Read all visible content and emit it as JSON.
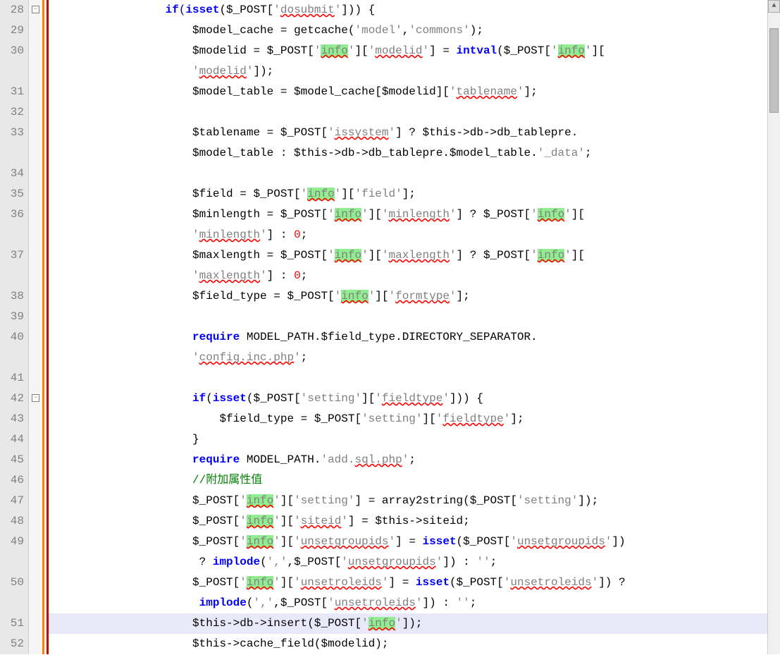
{
  "line_numbers": [
    "28",
    "29",
    "30",
    "31",
    "32",
    "33",
    "34",
    "35",
    "36",
    "37",
    "38",
    "39",
    "40",
    "41",
    "42",
    "43",
    "44",
    "45",
    "46",
    "47",
    "48",
    "49",
    "50",
    "51",
    "52"
  ],
  "tall_lines": [
    30,
    33,
    36,
    37,
    40,
    49,
    50
  ],
  "fold_marks": [
    {
      "line": 28,
      "type": "minus"
    },
    {
      "line": 42,
      "type": "minus"
    }
  ],
  "code": {
    "l28": {
      "indent": "                ",
      "tokens": [
        {
          "t": "if",
          "c": "kw"
        },
        {
          "t": "(",
          "c": "op"
        },
        {
          "t": "isset",
          "c": "kw"
        },
        {
          "t": "($_POST[",
          "c": "var"
        },
        {
          "t": "'",
          "c": "str"
        },
        {
          "t": "dosubmit",
          "c": "str wavy"
        },
        {
          "t": "'",
          "c": "str"
        },
        {
          "t": "])) {",
          "c": "var"
        }
      ]
    },
    "l29": {
      "indent": "                    ",
      "tokens": [
        {
          "t": "$model_cache = ",
          "c": "var"
        },
        {
          "t": "getcache",
          "c": "func"
        },
        {
          "t": "(",
          "c": "var"
        },
        {
          "t": "'model'",
          "c": "str"
        },
        {
          "t": ",",
          "c": "var"
        },
        {
          "t": "'commons'",
          "c": "str"
        },
        {
          "t": ");",
          "c": "var"
        }
      ]
    },
    "l30": {
      "indent": "                    ",
      "tokens": [
        {
          "t": "$modelid = $_POST[",
          "c": "var"
        },
        {
          "t": "'",
          "c": "str"
        },
        {
          "t": "info",
          "c": "str hl wavy"
        },
        {
          "t": "'",
          "c": "str"
        },
        {
          "t": "][",
          "c": "var"
        },
        {
          "t": "'",
          "c": "str"
        },
        {
          "t": "modelid",
          "c": "str wavy"
        },
        {
          "t": "'",
          "c": "str"
        },
        {
          "t": "] = ",
          "c": "var"
        },
        {
          "t": "intval",
          "c": "kw"
        },
        {
          "t": "($_POST[",
          "c": "var"
        },
        {
          "t": "'",
          "c": "str"
        },
        {
          "t": "info",
          "c": "str hl wavy"
        },
        {
          "t": "'",
          "c": "str"
        },
        {
          "t": "][",
          "c": "var"
        }
      ]
    },
    "l30b": {
      "indent": "                    ",
      "tokens": [
        {
          "t": "'",
          "c": "str"
        },
        {
          "t": "modelid",
          "c": "str wavy"
        },
        {
          "t": "'",
          "c": "str"
        },
        {
          "t": "]);",
          "c": "var"
        }
      ]
    },
    "l31": {
      "indent": "                    ",
      "tokens": [
        {
          "t": "$model_table = $model_cache[$modelid][",
          "c": "var"
        },
        {
          "t": "'",
          "c": "str"
        },
        {
          "t": "tablename",
          "c": "str wavy"
        },
        {
          "t": "'",
          "c": "str"
        },
        {
          "t": "];",
          "c": "var"
        }
      ]
    },
    "l32": {
      "indent": "",
      "tokens": []
    },
    "l33": {
      "indent": "                    ",
      "tokens": [
        {
          "t": "$tablename = $_POST[",
          "c": "var"
        },
        {
          "t": "'",
          "c": "str"
        },
        {
          "t": "issystem",
          "c": "str wavy"
        },
        {
          "t": "'",
          "c": "str"
        },
        {
          "t": "] ? $this->db->db_tablepre.",
          "c": "var"
        }
      ]
    },
    "l33b": {
      "indent": "                    ",
      "tokens": [
        {
          "t": "$model_table : $this->db->db_tablepre.$model_table.",
          "c": "var"
        },
        {
          "t": "'_data'",
          "c": "str"
        },
        {
          "t": ";",
          "c": "var"
        }
      ]
    },
    "l34": {
      "indent": "",
      "tokens": []
    },
    "l35": {
      "indent": "                    ",
      "tokens": [
        {
          "t": "$field = $_POST[",
          "c": "var"
        },
        {
          "t": "'",
          "c": "str"
        },
        {
          "t": "info",
          "c": "str hl wavy"
        },
        {
          "t": "'",
          "c": "str"
        },
        {
          "t": "][",
          "c": "var"
        },
        {
          "t": "'field'",
          "c": "str"
        },
        {
          "t": "];",
          "c": "var"
        }
      ]
    },
    "l36": {
      "indent": "                    ",
      "tokens": [
        {
          "t": "$minlength = $_POST[",
          "c": "var"
        },
        {
          "t": "'",
          "c": "str"
        },
        {
          "t": "info",
          "c": "str hl wavy"
        },
        {
          "t": "'",
          "c": "str"
        },
        {
          "t": "][",
          "c": "var"
        },
        {
          "t": "'",
          "c": "str"
        },
        {
          "t": "minlength",
          "c": "str wavy"
        },
        {
          "t": "'",
          "c": "str"
        },
        {
          "t": "] ? $_POST[",
          "c": "var"
        },
        {
          "t": "'",
          "c": "str"
        },
        {
          "t": "info",
          "c": "str hl wavy"
        },
        {
          "t": "'",
          "c": "str"
        },
        {
          "t": "][",
          "c": "var"
        }
      ]
    },
    "l36b": {
      "indent": "                    ",
      "tokens": [
        {
          "t": "'",
          "c": "str"
        },
        {
          "t": "minlength",
          "c": "str wavy"
        },
        {
          "t": "'",
          "c": "str"
        },
        {
          "t": "] : ",
          "c": "var"
        },
        {
          "t": "0",
          "c": "num"
        },
        {
          "t": ";",
          "c": "var"
        }
      ]
    },
    "l37": {
      "indent": "                    ",
      "tokens": [
        {
          "t": "$maxlength = $_POST[",
          "c": "var"
        },
        {
          "t": "'",
          "c": "str"
        },
        {
          "t": "info",
          "c": "str hl wavy"
        },
        {
          "t": "'",
          "c": "str"
        },
        {
          "t": "][",
          "c": "var"
        },
        {
          "t": "'",
          "c": "str"
        },
        {
          "t": "maxlength",
          "c": "str wavy"
        },
        {
          "t": "'",
          "c": "str"
        },
        {
          "t": "] ? $_POST[",
          "c": "var"
        },
        {
          "t": "'",
          "c": "str"
        },
        {
          "t": "info",
          "c": "str hl wavy"
        },
        {
          "t": "'",
          "c": "str"
        },
        {
          "t": "][",
          "c": "var"
        }
      ]
    },
    "l37b": {
      "indent": "                    ",
      "tokens": [
        {
          "t": "'",
          "c": "str"
        },
        {
          "t": "maxlength",
          "c": "str wavy"
        },
        {
          "t": "'",
          "c": "str"
        },
        {
          "t": "] : ",
          "c": "var"
        },
        {
          "t": "0",
          "c": "num"
        },
        {
          "t": ";",
          "c": "var"
        }
      ]
    },
    "l38": {
      "indent": "                    ",
      "tokens": [
        {
          "t": "$field_type = $_POST[",
          "c": "var"
        },
        {
          "t": "'",
          "c": "str"
        },
        {
          "t": "info",
          "c": "str hl wavy"
        },
        {
          "t": "'",
          "c": "str"
        },
        {
          "t": "][",
          "c": "var"
        },
        {
          "t": "'",
          "c": "str"
        },
        {
          "t": "formtype",
          "c": "str wavy"
        },
        {
          "t": "'",
          "c": "str"
        },
        {
          "t": "];",
          "c": "var"
        }
      ]
    },
    "l39": {
      "indent": "",
      "tokens": []
    },
    "l40": {
      "indent": "                    ",
      "tokens": [
        {
          "t": "require",
          "c": "kw"
        },
        {
          "t": " MODEL_PATH.$field_type.DIRECTORY_SEPARATOR.",
          "c": "var"
        }
      ]
    },
    "l40b": {
      "indent": "                    ",
      "tokens": [
        {
          "t": "'",
          "c": "str"
        },
        {
          "t": "config.inc.php",
          "c": "str wavy"
        },
        {
          "t": "'",
          "c": "str"
        },
        {
          "t": ";",
          "c": "var"
        }
      ]
    },
    "l41": {
      "indent": "",
      "tokens": []
    },
    "l42": {
      "indent": "                    ",
      "tokens": [
        {
          "t": "if",
          "c": "kw"
        },
        {
          "t": "(",
          "c": "var"
        },
        {
          "t": "isset",
          "c": "kw"
        },
        {
          "t": "($_POST[",
          "c": "var"
        },
        {
          "t": "'setting'",
          "c": "str"
        },
        {
          "t": "][",
          "c": "var"
        },
        {
          "t": "'",
          "c": "str"
        },
        {
          "t": "fieldtype",
          "c": "str wavy"
        },
        {
          "t": "'",
          "c": "str"
        },
        {
          "t": "])) {",
          "c": "var"
        }
      ]
    },
    "l43": {
      "indent": "                        ",
      "tokens": [
        {
          "t": "$field_type = $_POST[",
          "c": "var"
        },
        {
          "t": "'setting'",
          "c": "str"
        },
        {
          "t": "][",
          "c": "var"
        },
        {
          "t": "'",
          "c": "str"
        },
        {
          "t": "fieldtype",
          "c": "str wavy"
        },
        {
          "t": "'",
          "c": "str"
        },
        {
          "t": "];",
          "c": "var"
        }
      ]
    },
    "l44": {
      "indent": "                    ",
      "tokens": [
        {
          "t": "}",
          "c": "var"
        }
      ]
    },
    "l45": {
      "indent": "                    ",
      "tokens": [
        {
          "t": "require",
          "c": "kw"
        },
        {
          "t": " MODEL_PATH.",
          "c": "var"
        },
        {
          "t": "'add.",
          "c": "str"
        },
        {
          "t": "sql.php",
          "c": "str wavy"
        },
        {
          "t": "'",
          "c": "str"
        },
        {
          "t": ";",
          "c": "var"
        }
      ]
    },
    "l46": {
      "indent": "                    ",
      "tokens": [
        {
          "t": "//附加属性值",
          "c": "comment"
        }
      ]
    },
    "l47": {
      "indent": "                    ",
      "tokens": [
        {
          "t": "$_POST[",
          "c": "var"
        },
        {
          "t": "'",
          "c": "str"
        },
        {
          "t": "info",
          "c": "str hl wavy"
        },
        {
          "t": "'",
          "c": "str"
        },
        {
          "t": "][",
          "c": "var"
        },
        {
          "t": "'setting'",
          "c": "str"
        },
        {
          "t": "] = ",
          "c": "var"
        },
        {
          "t": "array2string",
          "c": "func"
        },
        {
          "t": "($_POST[",
          "c": "var"
        },
        {
          "t": "'setting'",
          "c": "str"
        },
        {
          "t": "]);",
          "c": "var"
        }
      ]
    },
    "l48": {
      "indent": "                    ",
      "tokens": [
        {
          "t": "$_POST[",
          "c": "var"
        },
        {
          "t": "'",
          "c": "str"
        },
        {
          "t": "info",
          "c": "str hl wavy"
        },
        {
          "t": "'",
          "c": "str"
        },
        {
          "t": "][",
          "c": "var"
        },
        {
          "t": "'",
          "c": "str"
        },
        {
          "t": "siteid",
          "c": "str wavy"
        },
        {
          "t": "'",
          "c": "str"
        },
        {
          "t": "] = $this->siteid;",
          "c": "var"
        }
      ]
    },
    "l49": {
      "indent": "                    ",
      "tokens": [
        {
          "t": "$_POST[",
          "c": "var"
        },
        {
          "t": "'",
          "c": "str"
        },
        {
          "t": "info",
          "c": "str hl wavy"
        },
        {
          "t": "'",
          "c": "str"
        },
        {
          "t": "][",
          "c": "var"
        },
        {
          "t": "'",
          "c": "str"
        },
        {
          "t": "unsetgroupids",
          "c": "str wavy"
        },
        {
          "t": "'",
          "c": "str"
        },
        {
          "t": "] = ",
          "c": "var"
        },
        {
          "t": "isset",
          "c": "kw"
        },
        {
          "t": "($_POST[",
          "c": "var"
        },
        {
          "t": "'",
          "c": "str"
        },
        {
          "t": "unsetgroupids",
          "c": "str wavy"
        },
        {
          "t": "'",
          "c": "str"
        },
        {
          "t": "])",
          "c": "var"
        }
      ]
    },
    "l49b": {
      "indent": "                     ",
      "tokens": [
        {
          "t": "? ",
          "c": "var"
        },
        {
          "t": "implode",
          "c": "kw"
        },
        {
          "t": "(",
          "c": "var"
        },
        {
          "t": "','",
          "c": "str"
        },
        {
          "t": ",$_POST[",
          "c": "var"
        },
        {
          "t": "'",
          "c": "str"
        },
        {
          "t": "unsetgroupids",
          "c": "str wavy"
        },
        {
          "t": "'",
          "c": "str"
        },
        {
          "t": "]) : ",
          "c": "var"
        },
        {
          "t": "''",
          "c": "str"
        },
        {
          "t": ";",
          "c": "var"
        }
      ]
    },
    "l50": {
      "indent": "                    ",
      "tokens": [
        {
          "t": "$_POST[",
          "c": "var"
        },
        {
          "t": "'",
          "c": "str"
        },
        {
          "t": "info",
          "c": "str hl wavy"
        },
        {
          "t": "'",
          "c": "str"
        },
        {
          "t": "][",
          "c": "var"
        },
        {
          "t": "'",
          "c": "str"
        },
        {
          "t": "unsetroleids",
          "c": "str wavy"
        },
        {
          "t": "'",
          "c": "str"
        },
        {
          "t": "] = ",
          "c": "var"
        },
        {
          "t": "isset",
          "c": "kw"
        },
        {
          "t": "($_POST[",
          "c": "var"
        },
        {
          "t": "'",
          "c": "str"
        },
        {
          "t": "unsetroleids",
          "c": "str wavy"
        },
        {
          "t": "'",
          "c": "str"
        },
        {
          "t": "]) ?",
          "c": "var"
        }
      ]
    },
    "l50b": {
      "indent": "                     ",
      "tokens": [
        {
          "t": "implode",
          "c": "kw"
        },
        {
          "t": "(",
          "c": "var"
        },
        {
          "t": "','",
          "c": "str"
        },
        {
          "t": ",$_POST[",
          "c": "var"
        },
        {
          "t": "'",
          "c": "str"
        },
        {
          "t": "unsetroleids",
          "c": "str wavy"
        },
        {
          "t": "'",
          "c": "str"
        },
        {
          "t": "]) : ",
          "c": "var"
        },
        {
          "t": "''",
          "c": "str"
        },
        {
          "t": ";",
          "c": "var"
        }
      ]
    },
    "l51": {
      "indent": "                    ",
      "tokens": [
        {
          "t": "$this->db->insert($_POST[",
          "c": "var"
        },
        {
          "t": "'",
          "c": "str"
        },
        {
          "t": "info",
          "c": "str hl wavy"
        },
        {
          "t": "'",
          "c": "str"
        },
        {
          "t": "]);",
          "c": "var"
        }
      ]
    },
    "l52": {
      "indent": "                    ",
      "tokens": [
        {
          "t": "$this->cache_field($modelid);",
          "c": "var"
        }
      ]
    }
  },
  "highlighted_line": 51,
  "line_order": [
    "l28",
    "l29",
    "l30",
    "l30b",
    "l31",
    "l32",
    "l33",
    "l33b",
    "l34",
    "l35",
    "l36",
    "l36b",
    "l37",
    "l37b",
    "l38",
    "l39",
    "l40",
    "l40b",
    "l41",
    "l42",
    "l43",
    "l44",
    "l45",
    "l46",
    "l47",
    "l48",
    "l49",
    "l49b",
    "l50",
    "l50b",
    "l51",
    "l52"
  ]
}
